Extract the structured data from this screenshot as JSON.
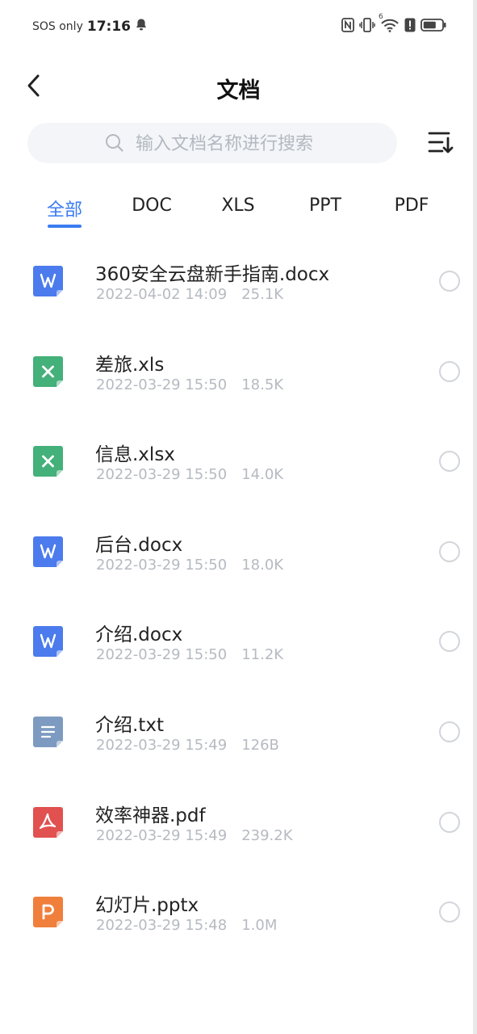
{
  "status_bar": {
    "sos": "SOS only",
    "time": "17:16",
    "icons": [
      "bell-icon",
      "nfc-icon",
      "vibrate-icon",
      "wifi-icon",
      "alert-icon",
      "battery-icon"
    ],
    "wifi_badge": "6"
  },
  "header": {
    "title": "文档"
  },
  "search": {
    "placeholder": "输入文档名称进行搜索",
    "value": ""
  },
  "tabs": [
    {
      "label": "全部",
      "active": true
    },
    {
      "label": "DOC",
      "active": false
    },
    {
      "label": "XLS",
      "active": false
    },
    {
      "label": "PPT",
      "active": false
    },
    {
      "label": "PDF",
      "active": false
    }
  ],
  "colors": {
    "accent": "#3a7bf0",
    "doc": "#4b7bec",
    "xls": "#44b07a",
    "txt": "#7d9bc1",
    "pdf": "#e0514f",
    "ppt": "#f07f3c"
  },
  "files": [
    {
      "name": "360安全云盘新手指南.docx",
      "date": "2022-04-02 14:09",
      "size": "25.1K",
      "type": "doc",
      "icon": "word-file-icon"
    },
    {
      "name": "差旅.xls",
      "date": "2022-03-29 15:50",
      "size": "18.5K",
      "type": "xls",
      "icon": "excel-file-icon"
    },
    {
      "name": "信息.xlsx",
      "date": "2022-03-29 15:50",
      "size": "14.0K",
      "type": "xls",
      "icon": "excel-file-icon"
    },
    {
      "name": "后台.docx",
      "date": "2022-03-29 15:50",
      "size": "18.0K",
      "type": "doc",
      "icon": "word-file-icon"
    },
    {
      "name": "介绍.docx",
      "date": "2022-03-29 15:50",
      "size": "11.2K",
      "type": "doc",
      "icon": "word-file-icon"
    },
    {
      "name": "介绍.txt",
      "date": "2022-03-29 15:49",
      "size": "126B",
      "type": "txt",
      "icon": "text-file-icon"
    },
    {
      "name": "效率神器.pdf",
      "date": "2022-03-29 15:49",
      "size": "239.2K",
      "type": "pdf",
      "icon": "pdf-file-icon"
    },
    {
      "name": "幻灯片.pptx",
      "date": "2022-03-29 15:48",
      "size": "1.0M",
      "type": "ppt",
      "icon": "ppt-file-icon"
    }
  ]
}
